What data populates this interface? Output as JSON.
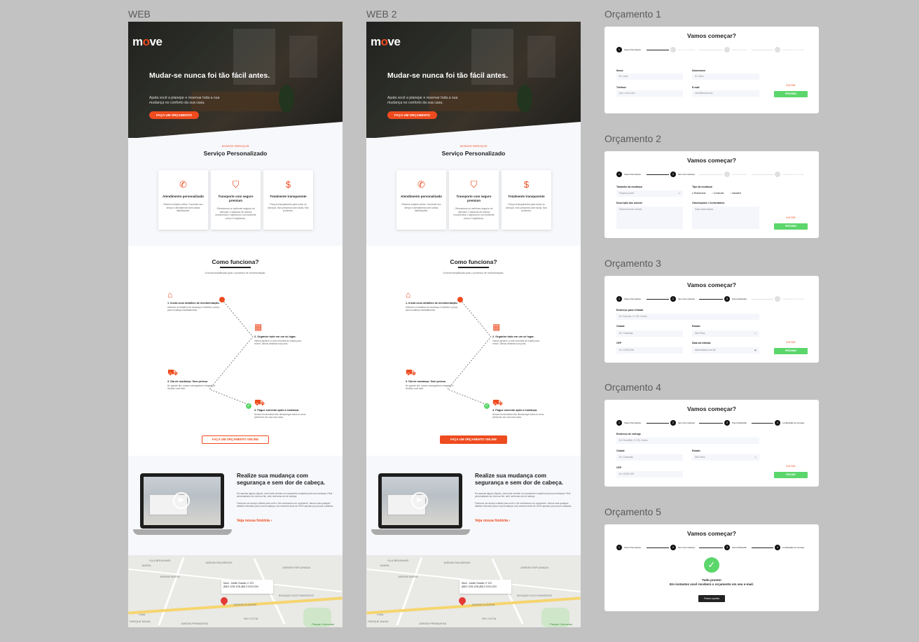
{
  "frames": {
    "web1_label": "WEB",
    "web2_label": "WEB 2",
    "q1_label": "Orçamento 1",
    "q2_label": "Orçamento 2",
    "q3_label": "Orçamento 3",
    "q4_label": "Orçamento 4",
    "q5_label": "Orçamento 5"
  },
  "web": {
    "logo_m": "m",
    "logo_o": "o",
    "logo_ve": "ve",
    "hero_title": "Mudar-se nunca foi tão fácil antes.",
    "hero_sub": "Ajuda você a planejar e reservar toda a sua mudança no conforto da sua casa.",
    "hero_cta": "FAÇA UM ORÇAMENTO",
    "services_kicker": "NOSSOS SERVIÇOS",
    "services_title": "Serviço Personalizado",
    "cards": [
      {
        "icon": "✆",
        "title": "Atendimento personalizado",
        "desc": "Reserve simples online. Converse seu tempo e atendimento sem várias distribuições."
      },
      {
        "icon": "⛉",
        "title": "Transporte com seguro premium",
        "desc": "Oferecemos os melhores seguros do mercado. Cuidamos de nossos movimentos e objetos por um excelente preço e segurança."
      },
      {
        "icon": "$",
        "title": "Totalmente transparente",
        "desc": "Preços transparentes para todos os serviços. Nós prezamos sem taxas. Nós podemos."
      }
    ],
    "how_title": "Como funciona?",
    "how_sub": "A forma simplificada para o processo de movimentação.",
    "steps": [
      {
        "title": "1. Insira seus detalhes de movimentação.",
        "desc": "Adicione os detalhes da mudança e obtenha o preço para mudança imediatamente."
      },
      {
        "title": "2. Organize tudo em um só lugar.",
        "desc": "Vamos ajudá-lo a criar uma lista de coisas para mover. Vamos detalhar tudo junto."
      },
      {
        "title": "3. Dia de mudança. Sem pressa.",
        "desc": "No grande dia, nossos carregadores chegarão e levarão você tudo."
      },
      {
        "title": "4. Pague somente após a mudança.",
        "desc": "Nossos funcionários irão descarregar todos os seus pertences em sua nova casa."
      }
    ],
    "how_cta": "FAÇA UM ORÇAMENTO ONLINE",
    "real_title": "Realize sua mudança com segurança e sem dor de cabeça.",
    "real_p1": "Em apenas alguns cliques, você pode receber um orçamento completo para sua mudança. Fácil personalizado do início ao fim, sem nenhuma dor de cabeça.",
    "real_p2": "Fazemos um serviço voltado para você e lhe enviaremos um orçamento. Vamos usar qualquer detalhe relevante para a sua mudança, dos menores itens de 100% apenas por poucos cuidados.",
    "real_link": "Veja nossa história",
    "map_card_l1": "Move - Jardim Claudia, nº 123",
    "map_card_l2": "(88) 9 1234-1234   (88) 9 1234-1234",
    "map_labels": [
      "VILA BRUNHARI",
      "MARIA",
      "JARDIM PALMEIRAS",
      "JARDIM MARIA",
      "JARDIM CLÁUDIA",
      "RIO COTIA",
      "PARQUE BAHIA",
      "Cotia",
      "JARDIM ESPLANADA",
      "BOSQUE DOS PINHEIROS",
      "JARDIM PRIMAVERA",
      "Parque Cemucam"
    ]
  },
  "quotes": {
    "title": "Vamos começar?",
    "steps": [
      "Suas informações",
      "Itens da mudança",
      "Sua localização",
      "Localização de entrega"
    ],
    "voltar": "VOLTAR",
    "proximo": "PRÓXIMO",
    "enviar": "ENVIAR",
    "q1": {
      "nome_label": "Nome",
      "nome_ph": "Ex: José",
      "sobrenome_label": "Sobrenome",
      "sobrenome_ph": "Ex: Silva",
      "telefone_label": "Telefone",
      "telefone_ph": "(xx) x xxxx-xxxx",
      "email_label": "E-mail",
      "email_ph": "ozeni@email.com"
    },
    "q2": {
      "tamanho_label": "Tamanho da mudança",
      "tamanho_val": "Pequeno porte",
      "tipo_label": "Tipo da mudança",
      "tipo_opts": [
        "Residencial",
        "Comercial",
        "Industrial"
      ],
      "descricao_label": "Descrição dos móveis",
      "descricao_ph": "Descreva seus móveis",
      "obs_label": "Observações / Comentários",
      "obs_ph": "Suas observações"
    },
    "q3": {
      "endereco_label": "Endereço para retirada",
      "endereco_ph": "Ex: Rua abc, nº 123, Centro",
      "cidade_label": "Cidade",
      "cidade_ph": "Ex: Campinas",
      "estado_label": "Estado",
      "estado_val": "São Paulo",
      "cep_label": "CEP",
      "cep_ph": "Ex: 12345-256",
      "data_label": "Data da retirada",
      "data_ph": "dd/mm/aaaa, mm-dd"
    },
    "q4": {
      "endereco_label": "Endereço de entrega",
      "endereco_ph": "Ex: Rua Afife, nº 175, Centro",
      "cidade_label": "Cidade",
      "cidade_ph": "Ex: Campinas",
      "estado_label": "Estado",
      "estado_val": "São Paulo",
      "cep_label": "CEP",
      "cep_ph": "Ex: 12345-789"
    },
    "q5": {
      "line1": "Tudo pronto!",
      "line2": "Em instantes você receberá o orçamento em seu e-mail.",
      "close": "Fechar a janela"
    }
  }
}
